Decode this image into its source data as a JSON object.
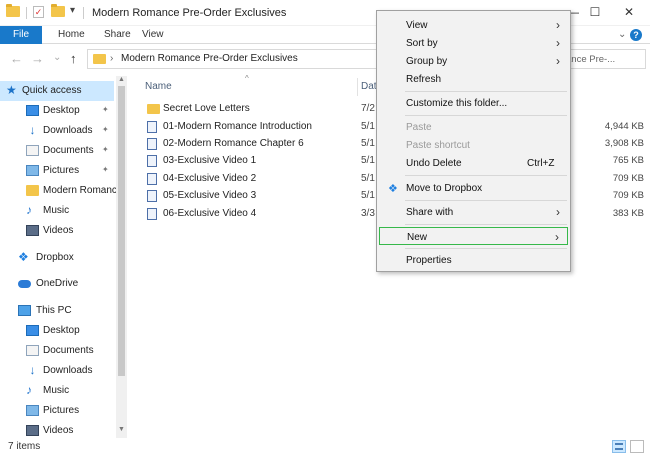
{
  "window": {
    "title": "Modern Romance Pre-Order Exclusives",
    "controls": {
      "minimize": "—",
      "maximize": "☐",
      "close": "✕"
    },
    "qa_dropdown": "▾"
  },
  "ribbon": {
    "tabs": [
      {
        "label": "File",
        "active": true
      },
      {
        "label": "Home"
      },
      {
        "label": "Share"
      },
      {
        "label": "View"
      }
    ],
    "expand": "⌄",
    "help": "?"
  },
  "address_bar": {
    "back": "←",
    "forward": "→",
    "recent": "⌄",
    "up": "↑",
    "chevron": "›",
    "path": "Modern Romance Pre-Order Exclusives",
    "refresh": "⌄",
    "search_visible_text": "ance Pre-..."
  },
  "nav_pane": {
    "items": [
      {
        "label": "Quick access",
        "icon": "star-icon",
        "selected": true
      },
      {
        "label": "Desktop",
        "icon": "desktop-icon",
        "pinned": true
      },
      {
        "label": "Downloads",
        "icon": "download-icon",
        "pinned": true
      },
      {
        "label": "Documents",
        "icon": "documents-icon",
        "pinned": true
      },
      {
        "label": "Pictures",
        "icon": "pictures-icon",
        "pinned": true
      },
      {
        "label": "Modern Romanc",
        "icon": "folder-icon"
      },
      {
        "label": "Music",
        "icon": "music-icon"
      },
      {
        "label": "Videos",
        "icon": "videos-icon"
      },
      {
        "label": "Dropbox",
        "icon": "dropbox-icon"
      },
      {
        "label": "OneDrive",
        "icon": "cloud-icon"
      },
      {
        "label": "This PC",
        "icon": "computer-icon"
      },
      {
        "label": "Desktop",
        "icon": "desktop-icon"
      },
      {
        "label": "Documents",
        "icon": "documents-icon"
      },
      {
        "label": "Downloads",
        "icon": "download-icon"
      },
      {
        "label": "Music",
        "icon": "music-icon"
      },
      {
        "label": "Pictures",
        "icon": "pictures-icon"
      },
      {
        "label": "Videos",
        "icon": "videos-icon"
      }
    ],
    "pin_glyph": "✦",
    "scroll_up": "▲",
    "scroll_down": "▼"
  },
  "file_list": {
    "columns": {
      "name": "Name",
      "date": "Dat",
      "sort_caret": "^"
    },
    "rows": [
      {
        "name": "Secret Love Letters",
        "date": "7/2",
        "size": "",
        "type": "folder"
      },
      {
        "name": "01-Modern Romance Introduction",
        "date": "5/1",
        "size": "4,944 KB",
        "type": "video"
      },
      {
        "name": "02-Modern Romance Chapter 6",
        "date": "5/1",
        "size": "3,908 KB",
        "type": "video"
      },
      {
        "name": "03-Exclusive Video 1",
        "date": "5/1",
        "size": "765 KB",
        "type": "video"
      },
      {
        "name": "04-Exclusive Video 2",
        "date": "5/1",
        "size": "709 KB",
        "type": "video"
      },
      {
        "name": "05-Exclusive Video 3",
        "date": "5/1",
        "size": "709 KB",
        "type": "video"
      },
      {
        "name": "06-Exclusive Video 4",
        "date": "3/3",
        "size": "383 KB",
        "type": "video"
      }
    ]
  },
  "context_menu": {
    "items": [
      {
        "label": "View",
        "submenu": true
      },
      {
        "label": "Sort by",
        "submenu": true
      },
      {
        "label": "Group by",
        "submenu": true
      },
      {
        "label": "Refresh"
      },
      {
        "label": "Customize this folder..."
      },
      {
        "label": "Paste",
        "disabled": true
      },
      {
        "label": "Paste shortcut",
        "disabled": true
      },
      {
        "label": "Undo Delete",
        "shortcut": "Ctrl+Z"
      },
      {
        "label": "Move to Dropbox",
        "icon": "dropbox-icon"
      },
      {
        "label": "Share with",
        "submenu": true
      },
      {
        "label": "New",
        "submenu": true,
        "highlighted": true
      },
      {
        "label": "Properties"
      }
    ],
    "submenu_arrow": "›",
    "highlight_color": "#36b84a"
  },
  "status_bar": {
    "item_count": "7 items"
  }
}
